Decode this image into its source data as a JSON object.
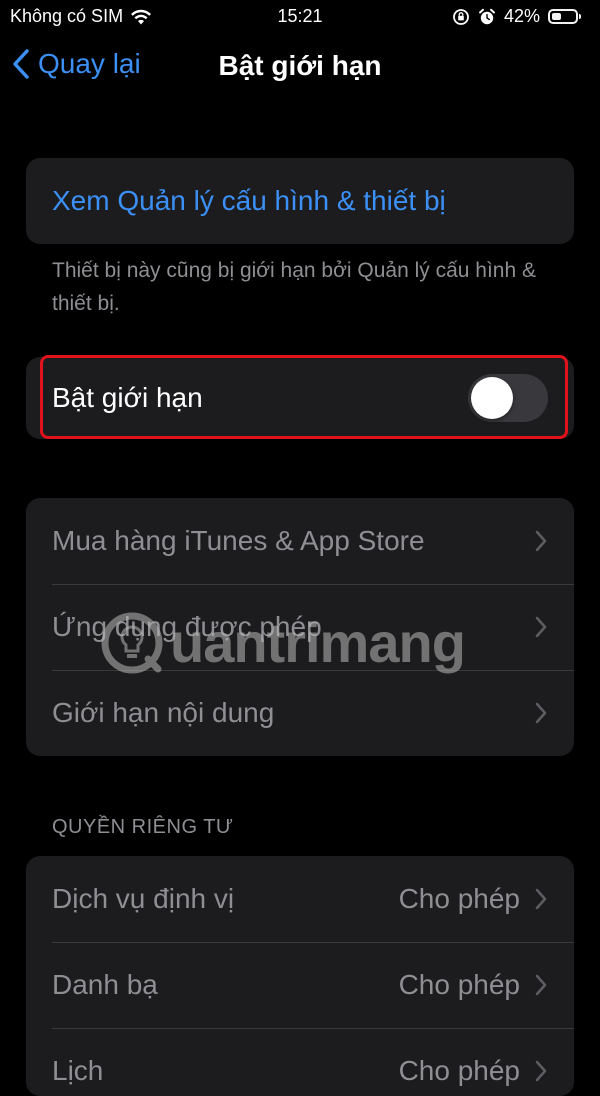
{
  "status_bar": {
    "carrier": "Không có SIM",
    "time": "15:21",
    "battery_percent": "42%",
    "battery_level": 0.42
  },
  "nav": {
    "back_label": "Quay lại",
    "title": "Bật giới hạn"
  },
  "profile_link": {
    "label": "Xem Quản lý cấu hình & thiết bị",
    "footnote": "Thiết bị này cũng bị giới hạn bởi Quản lý cấu hình & thiết bị."
  },
  "restrictions_toggle": {
    "label": "Bật giới hạn",
    "on": false
  },
  "store_group": {
    "items": [
      {
        "label": "Mua hàng iTunes & App Store"
      },
      {
        "label": "Ứng dụng được phép"
      },
      {
        "label": "Giới hạn nội dung"
      }
    ]
  },
  "privacy": {
    "header": "QUYỀN RIÊNG TƯ",
    "items": [
      {
        "label": "Dịch vụ định vị",
        "value": "Cho phép"
      },
      {
        "label": "Danh bạ",
        "value": "Cho phép"
      },
      {
        "label": "Lịch",
        "value": "Cho phép"
      }
    ]
  },
  "watermark": {
    "text": "uantrimang"
  },
  "colors": {
    "accent": "#3b8ff5",
    "highlight": "#e0121b",
    "cell_bg": "#1c1c1e",
    "secondary_text": "#8e8e93"
  }
}
